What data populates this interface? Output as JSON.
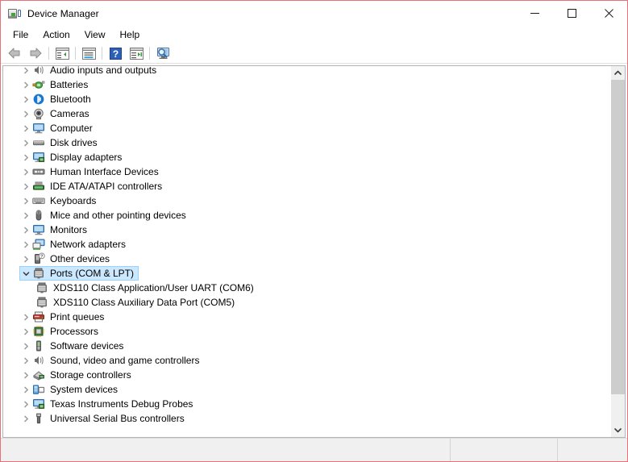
{
  "window": {
    "title": "Device Manager",
    "icon": "device-manager-icon",
    "border_color": "#e8707a",
    "controls": [
      {
        "name": "minimize-button",
        "glyph": "minimize"
      },
      {
        "name": "maximize-button",
        "glyph": "maximize"
      },
      {
        "name": "close-button",
        "glyph": "close"
      }
    ]
  },
  "menubar": {
    "items": [
      {
        "label": "File"
      },
      {
        "label": "Action"
      },
      {
        "label": "View"
      },
      {
        "label": "Help"
      }
    ]
  },
  "toolbar": {
    "buttons": [
      {
        "name": "back-button",
        "icon": "back-arrow-icon"
      },
      {
        "name": "forward-button",
        "icon": "forward-arrow-icon"
      },
      {
        "name": "separator-1",
        "icon": "separator"
      },
      {
        "name": "show-hide-console-tree-button",
        "icon": "console-tree-icon"
      },
      {
        "name": "separator-2",
        "icon": "separator"
      },
      {
        "name": "properties-button",
        "icon": "properties-icon"
      },
      {
        "name": "separator-3",
        "icon": "separator"
      },
      {
        "name": "help-button",
        "icon": "help-icon"
      },
      {
        "name": "update-driver-button",
        "icon": "update-driver-icon"
      },
      {
        "name": "separator-4",
        "icon": "separator"
      },
      {
        "name": "scan-for-hardware-changes-button",
        "icon": "scan-hardware-icon"
      }
    ]
  },
  "tree": {
    "selection_bg": "#cce8ff",
    "selection_border": "#99d1ff",
    "items": [
      {
        "label": "Audio inputs and outputs",
        "icon": "speaker-icon",
        "expander": "collapsed",
        "level": 0,
        "selected": false
      },
      {
        "label": "Batteries",
        "icon": "battery-icon",
        "expander": "collapsed",
        "level": 0,
        "selected": false
      },
      {
        "label": "Bluetooth",
        "icon": "bluetooth-icon",
        "expander": "collapsed",
        "level": 0,
        "selected": false
      },
      {
        "label": "Cameras",
        "icon": "camera-icon",
        "expander": "collapsed",
        "level": 0,
        "selected": false
      },
      {
        "label": "Computer",
        "icon": "monitor-icon",
        "expander": "collapsed",
        "level": 0,
        "selected": false
      },
      {
        "label": "Disk drives",
        "icon": "disk-drive-icon",
        "expander": "collapsed",
        "level": 0,
        "selected": false
      },
      {
        "label": "Display adapters",
        "icon": "display-adapter-icon",
        "expander": "collapsed",
        "level": 0,
        "selected": false
      },
      {
        "label": "Human Interface Devices",
        "icon": "hid-icon",
        "expander": "collapsed",
        "level": 0,
        "selected": false
      },
      {
        "label": "IDE ATA/ATAPI controllers",
        "icon": "ide-controller-icon",
        "expander": "collapsed",
        "level": 0,
        "selected": false
      },
      {
        "label": "Keyboards",
        "icon": "keyboard-icon",
        "expander": "collapsed",
        "level": 0,
        "selected": false
      },
      {
        "label": "Mice and other pointing devices",
        "icon": "mouse-icon",
        "expander": "collapsed",
        "level": 0,
        "selected": false
      },
      {
        "label": "Monitors",
        "icon": "monitor-icon",
        "expander": "collapsed",
        "level": 0,
        "selected": false
      },
      {
        "label": "Network adapters",
        "icon": "network-adapter-icon",
        "expander": "collapsed",
        "level": 0,
        "selected": false
      },
      {
        "label": "Other devices",
        "icon": "unknown-device-icon",
        "expander": "collapsed",
        "level": 0,
        "selected": false
      },
      {
        "label": "Ports (COM & LPT)",
        "icon": "port-icon",
        "expander": "expanded",
        "level": 0,
        "selected": true
      },
      {
        "label": "XDS110 Class Application/User UART (COM6)",
        "icon": "port-icon",
        "expander": "none",
        "level": 1,
        "selected": false
      },
      {
        "label": "XDS110 Class Auxiliary Data Port (COM5)",
        "icon": "port-icon",
        "expander": "none",
        "level": 1,
        "selected": false
      },
      {
        "label": "Print queues",
        "icon": "printer-icon",
        "expander": "collapsed",
        "level": 0,
        "selected": false
      },
      {
        "label": "Processors",
        "icon": "processor-icon",
        "expander": "collapsed",
        "level": 0,
        "selected": false
      },
      {
        "label": "Software devices",
        "icon": "software-device-icon",
        "expander": "collapsed",
        "level": 0,
        "selected": false
      },
      {
        "label": "Sound, video and game controllers",
        "icon": "speaker-icon",
        "expander": "collapsed",
        "level": 0,
        "selected": false
      },
      {
        "label": "Storage controllers",
        "icon": "storage-controller-icon",
        "expander": "collapsed",
        "level": 0,
        "selected": false
      },
      {
        "label": "System devices",
        "icon": "system-device-icon",
        "expander": "collapsed",
        "level": 0,
        "selected": false
      },
      {
        "label": "Texas Instruments Debug Probes",
        "icon": "display-adapter-icon",
        "expander": "collapsed",
        "level": 0,
        "selected": false
      },
      {
        "label": "Universal Serial Bus controllers",
        "icon": "usb-icon",
        "expander": "collapsed",
        "level": 0,
        "selected": false
      }
    ]
  },
  "scrollbar": {
    "up_button": "scroll-up-button",
    "down_button": "scroll-down-button",
    "thumb": "scroll-thumb"
  },
  "statusbar": {
    "pane1": "",
    "pane2": "",
    "pane3": ""
  }
}
